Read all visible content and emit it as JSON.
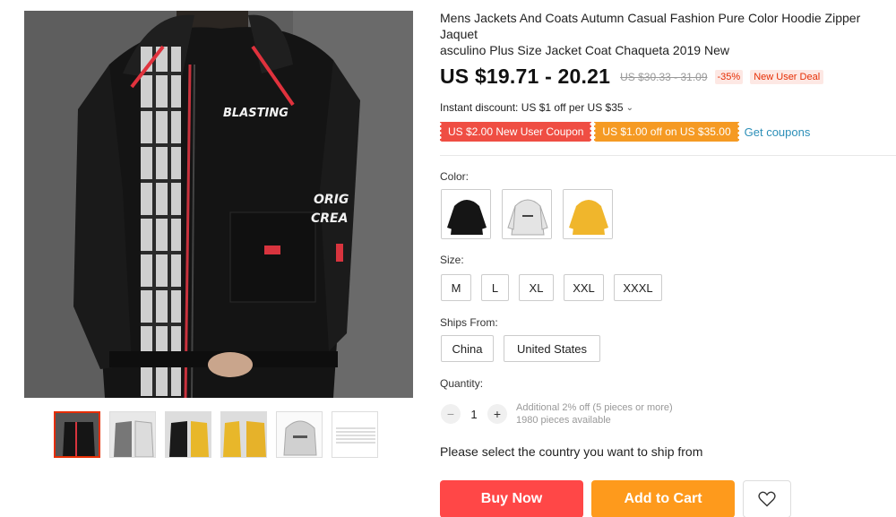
{
  "product": {
    "title": "Mens Jackets And Coats Autumn Casual Fashion Pure Color Hoodie Zipper Jaquet\nasculino Plus Size Jacket Coat Chaqueta 2019 New",
    "image_print_main": "BLASTING",
    "image_print_sleeve_1": "ORIG",
    "image_print_sleeve_2": "CREA"
  },
  "price": {
    "current": "US $19.71 - 20.21",
    "original": "US $30.33 - 31.09",
    "discount": "-35%",
    "deal": "New User Deal"
  },
  "instant_discount": {
    "label": "Instant discount: US $1 off per US $35",
    "icon": "chevron-down-icon"
  },
  "coupons": {
    "items": [
      "US $2.00 New User Coupon",
      "US $1.00 off on US $35.00"
    ],
    "get_label": "Get coupons"
  },
  "color": {
    "label": "Color:",
    "options": [
      "black",
      "white",
      "yellow"
    ]
  },
  "size": {
    "label": "Size:",
    "options": [
      "M",
      "L",
      "XL",
      "XXL",
      "XXXL"
    ]
  },
  "ships_from": {
    "label": "Ships From:",
    "options": [
      "China",
      "United States"
    ]
  },
  "quantity": {
    "label": "Quantity:",
    "minus": "−",
    "value": "1",
    "plus": "+",
    "info_1": "Additional 2% off (5 pieces or more)",
    "info_2": "1980 pieces available"
  },
  "ship_note": "Please select the country you want to ship from",
  "actions": {
    "buy": "Buy Now",
    "cart": "Add to Cart",
    "wishlist_icon": "heart-icon"
  },
  "colors": {
    "accent_red": "#ff4747",
    "accent_orange": "#fe9a1c",
    "link_blue": "#2c8fb8"
  }
}
